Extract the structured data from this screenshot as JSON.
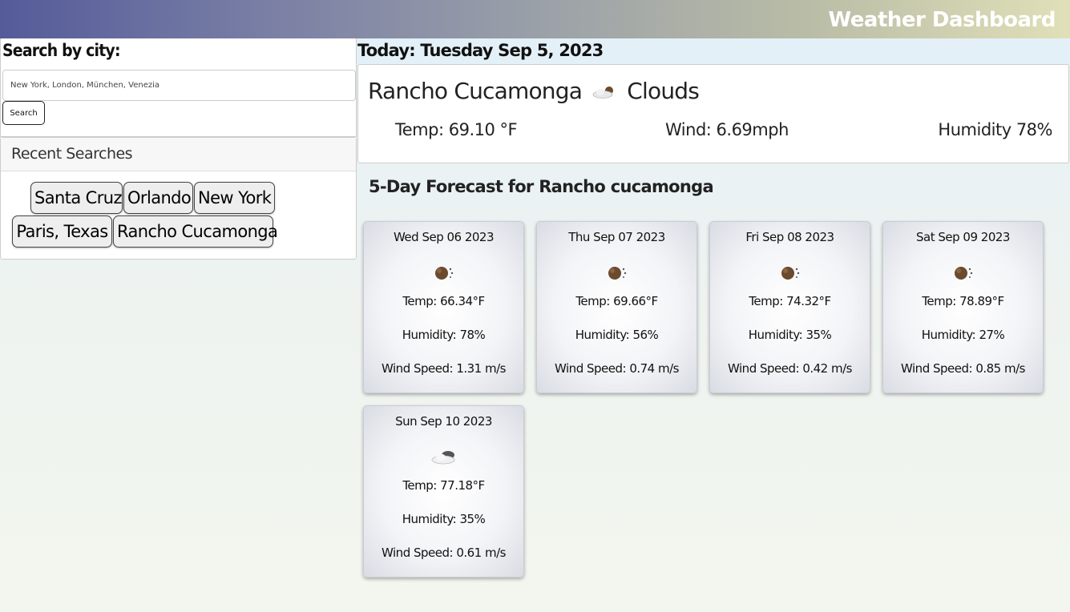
{
  "header": {
    "title": "Weather Dashboard"
  },
  "search": {
    "label": "Search by city:",
    "placeholder": "New York, London, München, Venezia",
    "button_label": "Search"
  },
  "recent": {
    "title": "Recent Searches",
    "items": [
      "Santa Cruz",
      "Orlando",
      "New York",
      "Paris, Texas",
      "Rancho Cucamonga"
    ]
  },
  "today": {
    "label": "Today: Tuesday Sep 5, 2023"
  },
  "current": {
    "city": "Rancho Cucamonga",
    "icon": "clouds-icon",
    "condition": "Clouds",
    "temp": "Temp: 69.10 °F",
    "wind": "Wind: 6.69mph",
    "humidity": "Humidity 78%"
  },
  "forecast": {
    "heading": "5-Day Forecast for Rancho cucamonga",
    "days": [
      {
        "date": "Wed Sep 06 2023",
        "icon": "clear-sky-icon",
        "temp": "Temp: 66.34°F",
        "humidity": "Humidity: 78%",
        "wind": "Wind Speed: 1.31 m/s"
      },
      {
        "date": "Thu Sep 07 2023",
        "icon": "clear-sky-icon",
        "temp": "Temp: 69.66°F",
        "humidity": "Humidity: 56%",
        "wind": "Wind Speed: 0.74 m/s"
      },
      {
        "date": "Fri Sep 08 2023",
        "icon": "clear-sky-icon",
        "temp": "Temp: 74.32°F",
        "humidity": "Humidity: 35%",
        "wind": "Wind Speed: 0.42 m/s"
      },
      {
        "date": "Sat Sep 09 2023",
        "icon": "clear-sky-icon",
        "temp": "Temp: 78.89°F",
        "humidity": "Humidity: 27%",
        "wind": "Wind Speed: 0.85 m/s"
      },
      {
        "date": "Sun Sep 10 2023",
        "icon": "clouds-icon",
        "temp": "Temp: 77.18°F",
        "humidity": "Humidity: 35%",
        "wind": "Wind Speed: 0.61 m/s"
      }
    ]
  }
}
